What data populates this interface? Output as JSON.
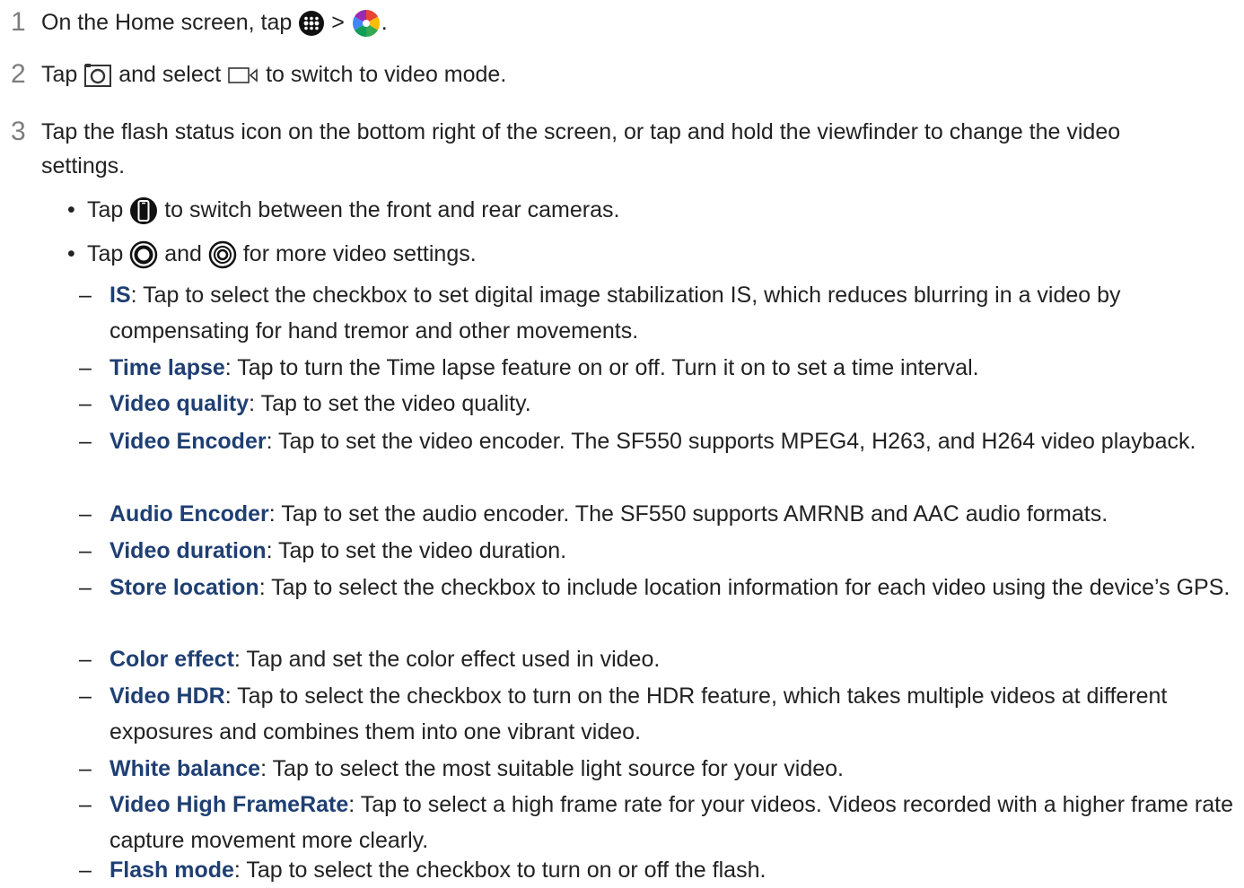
{
  "steps": [
    {
      "num": "1",
      "a": "On the Home screen, tap",
      "b": ">",
      "c": "."
    },
    {
      "num": "2",
      "a": "Tap",
      "b": "and select",
      "c": "to switch to video mode."
    },
    {
      "num": "3",
      "text": "Tap the flash status icon on the bottom right of the screen, or tap and hold the viewfinder to change the video settings."
    }
  ],
  "bullets": [
    {
      "a": "Tap",
      "b": "to switch between the front and rear cameras."
    },
    {
      "a": "Tap",
      "b": "and",
      "c": "for more video settings."
    }
  ],
  "settings": [
    {
      "label": "IS",
      "desc": ": Tap to select the checkbox to set digital image stabilization IS, which reduces blurring in a video by compensating for hand tremor and other movements."
    },
    {
      "label": "Time lapse",
      "desc": ": Tap to turn the Time lapse feature on or off. Turn it on to set a time interval."
    },
    {
      "label": "Video quality",
      "desc": ": Tap to set the video quality."
    },
    {
      "label": "Video Encoder",
      "desc": ": Tap to set the video encoder. The SF550 supports MPEG4, H263, and H264 video playback."
    },
    {
      "label": "Audio Encoder",
      "desc": ": Tap to set the audio encoder. The SF550 supports AMRNB and AAC audio formats."
    },
    {
      "label": "Video duration",
      "desc": ": Tap to set the video duration."
    },
    {
      "label": "Store location",
      "desc": ": Tap to select the checkbox to include location information for each video using the device’s GPS."
    },
    {
      "label": "Color effect",
      "desc": ": Tap and set the color effect used in video."
    },
    {
      "label": "Video HDR",
      "desc": ": Tap to select the checkbox to turn on the HDR feature, which takes multiple videos at different exposures and combines them into one vibrant video."
    },
    {
      "label": "White balance",
      "desc": ": Tap to select the most suitable light source for your video."
    },
    {
      "label": "Video High FrameRate",
      "desc": ": Tap to select a high frame rate for your videos. Videos recorded with a higher frame rate capture movement more clearly."
    },
    {
      "label": "Flash mode",
      "desc": ": Tap to select the checkbox to turn on or off the flash."
    }
  ],
  "symbols": {
    "bullet": "•",
    "dash": "–"
  },
  "icons": [
    "apps-icon",
    "camera-app-icon",
    "camera-mode-icon",
    "video-mode-icon",
    "switch-camera-icon",
    "settings-icon",
    "advanced-settings-icon"
  ]
}
